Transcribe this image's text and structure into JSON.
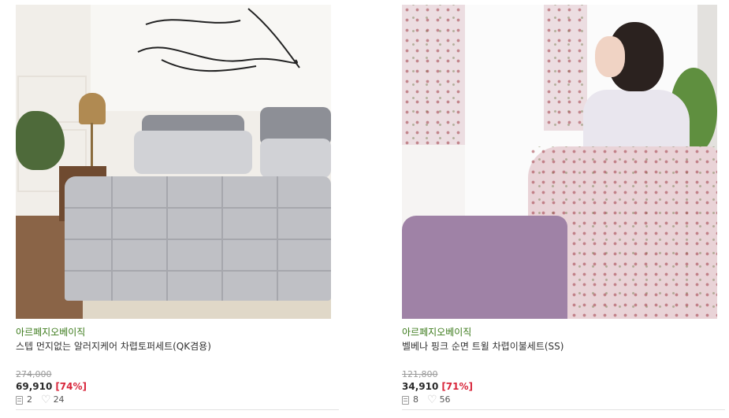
{
  "products": [
    {
      "image_alt": "grey quilted duvet set in bedroom",
      "brand": "아르페지오베이직",
      "title": "스텝 먼지없는 알러지케어 차렵토퍼세트(QK겸용)",
      "original_price": "274,000",
      "price": "69,910",
      "discount": "[74%]",
      "reviews": "2",
      "likes": "24"
    },
    {
      "image_alt": "pink floral bedding with woman sitting",
      "brand": "아르페지오베이직",
      "title": "벨베나 핑크 순면 트윌 차렵이불세트(SS)",
      "original_price": "121,800",
      "price": "34,910",
      "discount": "[71%]",
      "reviews": "8",
      "likes": "56"
    }
  ],
  "icons": {
    "review": "review-icon",
    "like": "heart-icon"
  },
  "colors": {
    "brand": "#3b7a1a",
    "discount": "#d8263b"
  }
}
